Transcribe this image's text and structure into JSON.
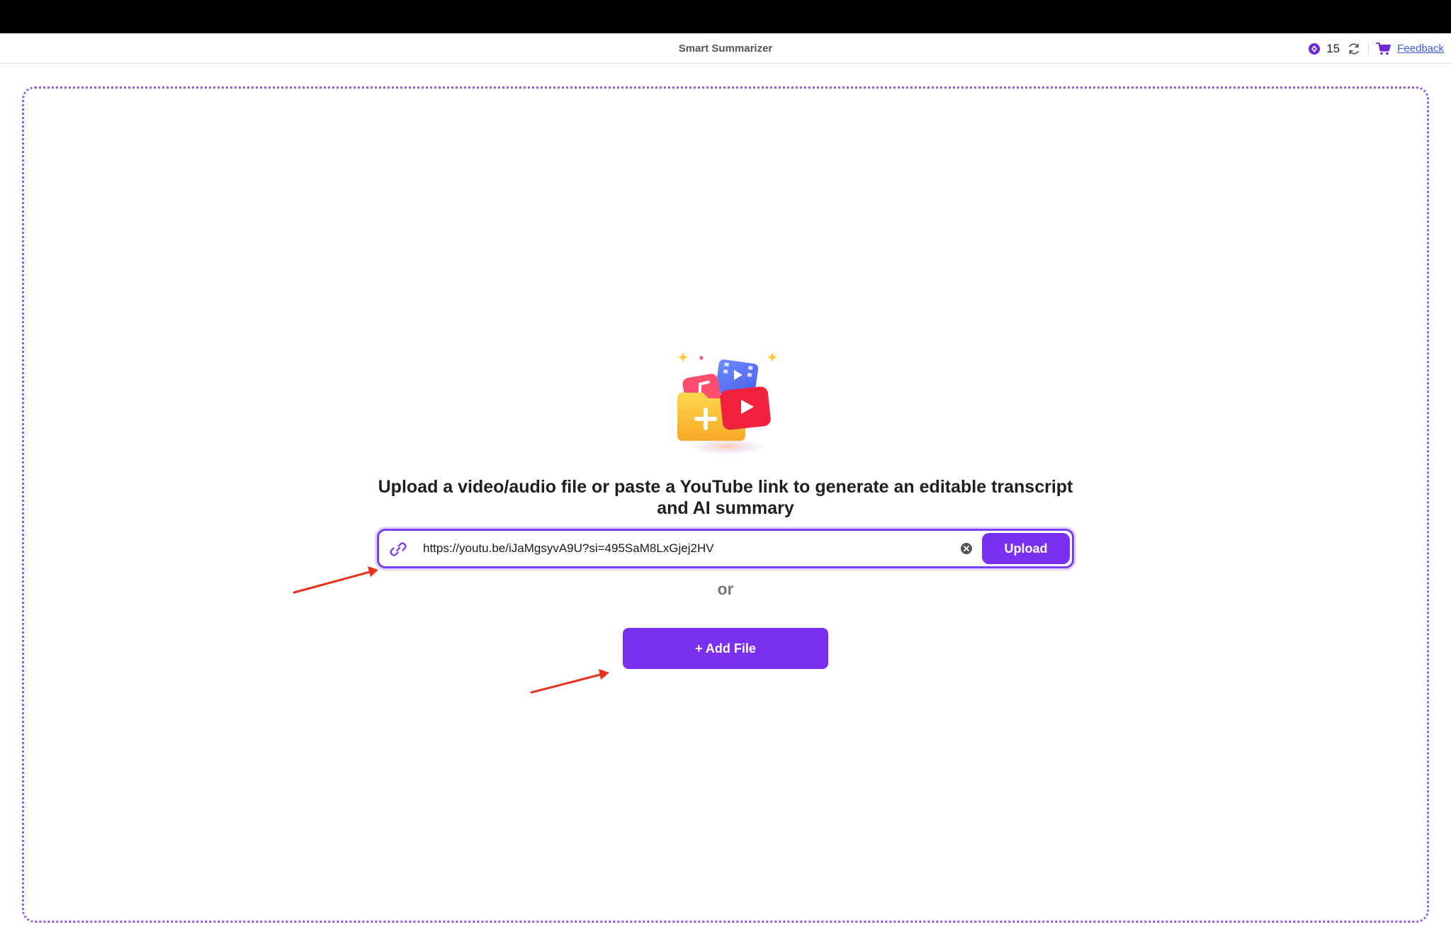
{
  "header": {
    "title": "Smart Summarizer",
    "credits": "15",
    "feedback_label": "Feedback"
  },
  "upload": {
    "headline": "Upload a video/audio file or paste a YouTube link to generate an editable transcript and AI summary",
    "url_value": "https://youtu.be/iJaMgsyvA9U?si=495SaM8LxGjej2HV",
    "upload_label": "Upload",
    "or_label": "or",
    "add_file_label": "+ Add File"
  },
  "icons": {
    "credits": "coin-icon",
    "refresh": "refresh-icon",
    "cart": "cart-icon",
    "link": "link-icon",
    "clear": "clear-icon",
    "illustration": "media-folder-illustration",
    "annotation": "arrow-icon"
  },
  "colors": {
    "accent": "#7b2ff1",
    "dropzone_border": "#8d5df0",
    "link": "#3b5bdb",
    "annotation_arrow": "#e8321e"
  }
}
